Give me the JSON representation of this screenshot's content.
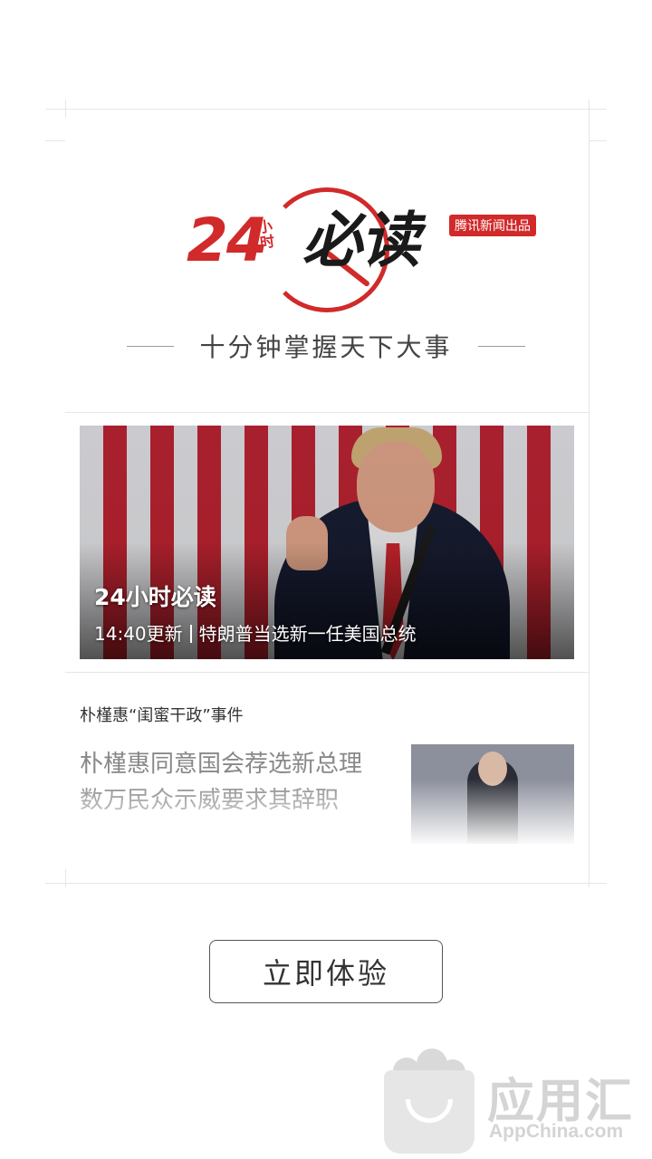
{
  "logo": {
    "number": "24",
    "small": "小时",
    "word": "必读",
    "tag": "腾讯新闻出品"
  },
  "slogan": "十分钟掌握天下大事",
  "hero": {
    "title": "24小时必读",
    "time": "14:40更新",
    "headline": "特朗普当选新一任美国总统"
  },
  "news": {
    "topic": "朴槿惠“闺蜜干政”事件",
    "title": "朴槿惠同意国会荐选新总理 数万民众示威要求其辞职"
  },
  "cta_label": "立即体验",
  "watermark": {
    "name": "应用汇",
    "url": "AppChina.com"
  },
  "colors": {
    "brand_red": "#d12a2a",
    "text_gray": "#888888"
  }
}
